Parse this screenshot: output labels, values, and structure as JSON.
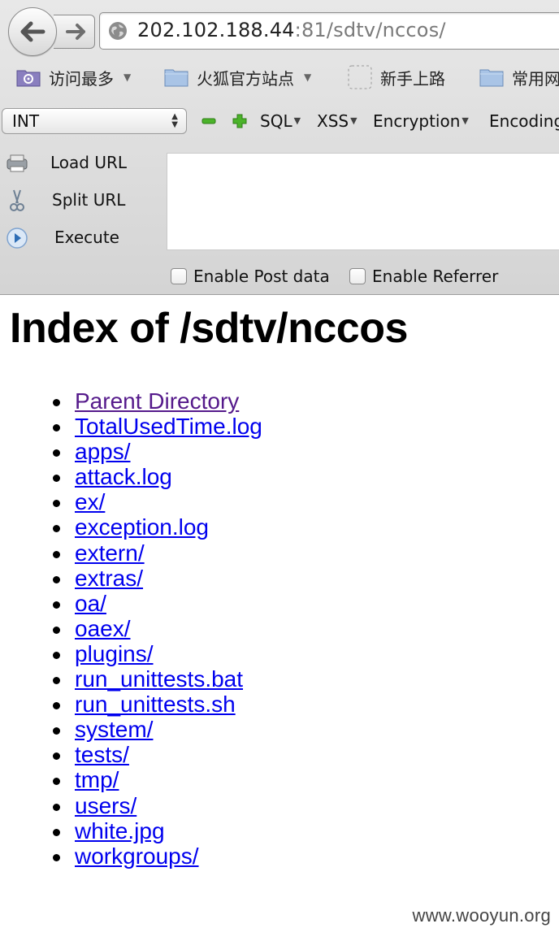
{
  "browser": {
    "url_host": "202.102.188.44",
    "url_rest": ":81/sdtv/nccos/"
  },
  "bookmarks": [
    {
      "label": "访问最多",
      "icon": "gear-folder-icon",
      "has_menu": true
    },
    {
      "label": "火狐官方站点",
      "icon": "folder-icon",
      "has_menu": true
    },
    {
      "label": "新手上路",
      "icon": "dashed-box-icon",
      "has_menu": false
    },
    {
      "label": "常用网",
      "icon": "folder-icon",
      "has_menu": false
    }
  ],
  "hackbar": {
    "select_value": "INT",
    "menus": [
      "SQL",
      "XSS",
      "Encryption",
      "Encoding"
    ],
    "buttons": [
      "Load URL",
      "Split URL",
      "Execute"
    ],
    "checkboxes": [
      "Enable Post data",
      "Enable Referrer"
    ],
    "textarea_value": ""
  },
  "page": {
    "heading": "Index of /sdtv/nccos",
    "items": [
      {
        "label": "Parent Directory",
        "visited": true
      },
      {
        "label": "TotalUsedTime.log"
      },
      {
        "label": "apps/"
      },
      {
        "label": "attack.log"
      },
      {
        "label": "ex/"
      },
      {
        "label": "exception.log"
      },
      {
        "label": "extern/"
      },
      {
        "label": "extras/"
      },
      {
        "label": "oa/"
      },
      {
        "label": "oaex/"
      },
      {
        "label": "plugins/"
      },
      {
        "label": "run_unittests.bat"
      },
      {
        "label": "run_unittests.sh"
      },
      {
        "label": "system/"
      },
      {
        "label": "tests/"
      },
      {
        "label": "tmp/"
      },
      {
        "label": "users/"
      },
      {
        "label": "white.jpg"
      },
      {
        "label": "workgroups/"
      }
    ]
  },
  "watermark": "www.wooyun.org",
  "colors": {
    "link": "#0000ee",
    "visited_link": "#551a8b",
    "chrome_bg": "#dcdcdc"
  }
}
